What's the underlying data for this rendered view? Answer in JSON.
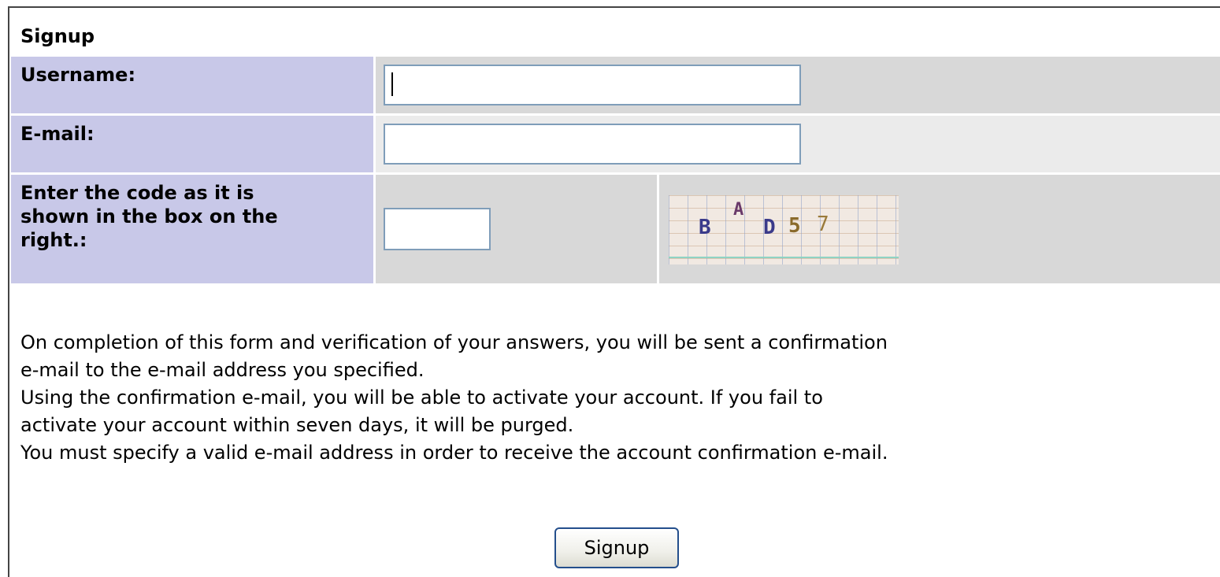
{
  "form": {
    "title": "Signup",
    "username": {
      "label": "Username:",
      "value": ""
    },
    "email": {
      "label": "E-mail:",
      "value": ""
    },
    "code": {
      "label_lines": [
        "Enter the code as it is",
        "shown in the box on the",
        "right.:"
      ],
      "value": "",
      "captcha_chars": [
        "B",
        "A",
        "D",
        "5",
        "7"
      ]
    },
    "info_lines": [
      "On completion of this form and verification of your answers, you will be sent a confirmation",
      "e-mail to the e-mail address you specified.",
      "Using the confirmation e-mail, you will be able to activate your account. If you fail to",
      "activate your account within seven days, it will be purged.",
      "You must specify a valid e-mail address in order to receive the account confirmation e-mail."
    ],
    "submit_label": "Signup"
  },
  "colors": {
    "label_background": "#c8c8e8",
    "field_background_dark": "#d8d8d8",
    "field_background_light": "#ebebeb",
    "input_border": "#7f9db9",
    "button_border": "#244f8c"
  }
}
